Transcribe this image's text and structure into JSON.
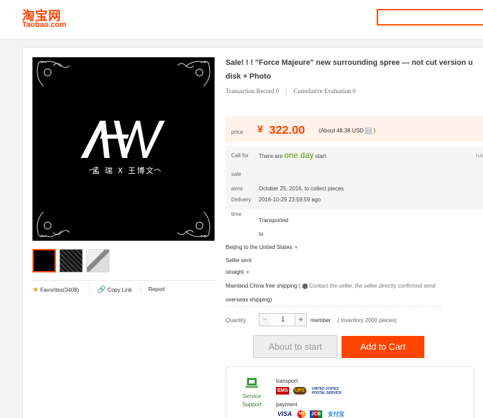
{
  "brand": {
    "name_cn": "淘宝网",
    "name_en": "Taobao.com",
    "color": "#ff4400"
  },
  "search": {
    "placeholder": ""
  },
  "product": {
    "title": "Sale! ! ! \"Force Majeure\" new surrounding spree --- not cut version u disk + Photo",
    "cover_logo": "AW",
    "cover_artist": "孟 瑞  X  王博文",
    "transaction_record": "Transaction Record 0",
    "cumulative_evaluation": "Cumulative Evaluation 0"
  },
  "social": {
    "favorites": "Favorites(3408)",
    "copy_link": "Copy Link",
    "report": "Report"
  },
  "price": {
    "label": "price",
    "currency_symbol": "¥",
    "amount": "322.00",
    "about": "(About 48.38 USD",
    "help_icon": "?",
    "close": ")"
  },
  "promo": {
    "call_for": "Call for",
    "sale": "sale",
    "start_prefix": "There are",
    "start_highlight": "one day",
    "start_suffix": "start",
    "rule": "rule",
    "aims": "aims",
    "aims_value": "October 25, 2016, to collect pieces",
    "delivery": "Delivery",
    "delivery_value": "2016-10-29 23:59:59 ago",
    "time": "time",
    "transported": "Transported",
    "to": "to"
  },
  "shipping": {
    "from": "Beijing to",
    "destination": "the United States",
    "seller_sent": "Seller sent",
    "straight": "straight",
    "free_shipping": "Mainland China free shipping (",
    "contact_note": "Contact the seller, the seller directly confirmed send",
    "overseas": "overseas shipping)"
  },
  "quantity": {
    "label": "Quantity",
    "value": "1",
    "unit": "member",
    "inventory": "( Inventory 2000 pieces)"
  },
  "buttons": {
    "about_to_start": "About to start",
    "add_to_cart": "Add to Cart"
  },
  "service": {
    "label_line1": "Service",
    "label_line2": "Support",
    "transport": "transport",
    "payment": "payment",
    "transport_logos": [
      "EMS",
      "UPS",
      "UNITED STATES POSTAL SERVICE"
    ],
    "payment_logos": [
      "VISA",
      "MC",
      "JCB",
      "支付宝"
    ]
  }
}
